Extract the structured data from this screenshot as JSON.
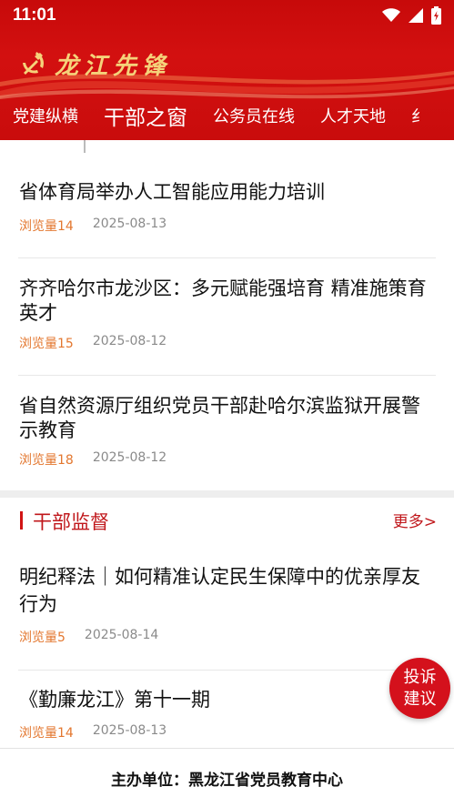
{
  "status_bar": {
    "time": "11:01",
    "icons": [
      "wifi-icon",
      "signal-icon",
      "battery-charging-icon"
    ]
  },
  "brand": {
    "name": "龙江先锋",
    "logo_icon": "party-emblem-icon"
  },
  "colors": {
    "header_red": "#cc0e0e",
    "accent_red": "#c0171b",
    "views_orange": "#e3772f",
    "brand_gold": "#f5d27a"
  },
  "tabs": [
    {
      "label": "党建纵横",
      "active": false
    },
    {
      "label": "干部之窗",
      "active": true
    },
    {
      "label": "公务员在线",
      "active": false
    },
    {
      "label": "人才天地",
      "active": false
    },
    {
      "label": "纟",
      "active": false
    }
  ],
  "articles_top": [
    {
      "title": "省体育局举办人工智能应用能力培训",
      "views": "浏览量14",
      "date": "2025-08-13"
    },
    {
      "title": "齐齐哈尔市龙沙区：多元赋能强培育 精准施策育英才",
      "views": "浏览量15",
      "date": "2025-08-12"
    },
    {
      "title": "省自然资源厅组织党员干部赴哈尔滨监狱开展警示教育",
      "views": "浏览量18",
      "date": "2025-08-12"
    }
  ],
  "section": {
    "title": "干部监督",
    "more": "更多>"
  },
  "articles_section": [
    {
      "title": "明纪释法｜如何精准认定民生保障中的优亲厚友行为",
      "views": "浏览量5",
      "date": "2025-08-14"
    },
    {
      "title": "《勤廉龙江》第十一期",
      "views": "浏览量14",
      "date": "2025-08-13"
    }
  ],
  "fab": {
    "label": "投诉建议"
  },
  "footer": {
    "text": "主办单位：黑龙江省党员教育中心"
  }
}
